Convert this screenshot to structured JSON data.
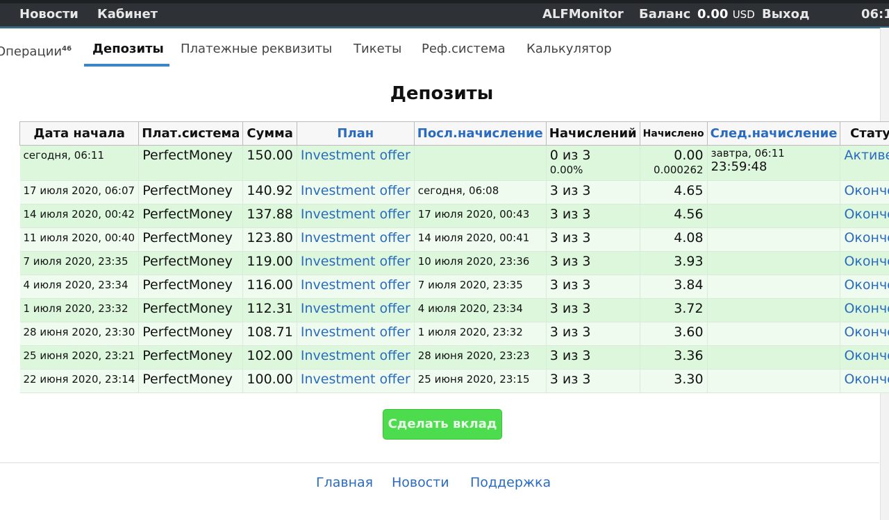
{
  "topbar": {
    "news": "Новости",
    "cabinet": "Кабинет",
    "username": "ALFMonitor",
    "balance_label": "Баланс",
    "balance_value": "0.00",
    "balance_currency": "USD",
    "logout": "Выход",
    "clock": "06:1"
  },
  "tabs": {
    "operations": "Операции",
    "operations_count": "46",
    "deposits": "Депозиты",
    "payment_details": "Платежные реквизиты",
    "tickets": "Тикеты",
    "referral": "Реф.система",
    "calculator": "Калькулятор"
  },
  "page": {
    "title": "Депозиты"
  },
  "table": {
    "headers": {
      "start_date": "Дата начала",
      "pay_system": "Плат.система",
      "amount": "Сумма",
      "plan": "План",
      "last_accrual": "Посл.начисление",
      "accruals": "Начислений",
      "accrued": "Начислено",
      "next_accrual": "След.начисление",
      "status": "Статус"
    },
    "rows": [
      {
        "start_date": "сегодня, 06:11",
        "pay_system": "PerfectMoney",
        "amount": "150.00",
        "plan": "Investment offer",
        "last_accrual": "",
        "accruals": "0 из 3",
        "accruals_pct": "0.00%",
        "accrued": "0.00",
        "accrued_sub": "0.000262",
        "next_accrual": "завтра, 06:11",
        "next_timer": "23:59:48",
        "status": "Активен"
      },
      {
        "start_date": "17 июля 2020, 06:07",
        "pay_system": "PerfectMoney",
        "amount": "140.92",
        "plan": "Investment offer",
        "last_accrual": "сегодня, 06:08",
        "accruals": "3 из 3",
        "accrued": "4.65",
        "status": "Окончен"
      },
      {
        "start_date": "14 июля 2020, 00:42",
        "pay_system": "PerfectMoney",
        "amount": "137.88",
        "plan": "Investment offer",
        "last_accrual": "17 июля 2020, 00:43",
        "accruals": "3 из 3",
        "accrued": "4.56",
        "status": "Окончен"
      },
      {
        "start_date": "11 июля 2020, 00:40",
        "pay_system": "PerfectMoney",
        "amount": "123.80",
        "plan": "Investment offer",
        "last_accrual": "14 июля 2020, 00:41",
        "accruals": "3 из 3",
        "accrued": "4.08",
        "status": "Окончен"
      },
      {
        "start_date": "7 июля 2020, 23:35",
        "pay_system": "PerfectMoney",
        "amount": "119.00",
        "plan": "Investment offer",
        "last_accrual": "10 июля 2020, 23:36",
        "accruals": "3 из 3",
        "accrued": "3.93",
        "status": "Окончен"
      },
      {
        "start_date": "4 июля 2020, 23:34",
        "pay_system": "PerfectMoney",
        "amount": "116.00",
        "plan": "Investment offer",
        "last_accrual": "7 июля 2020, 23:35",
        "accruals": "3 из 3",
        "accrued": "3.84",
        "status": "Окончен"
      },
      {
        "start_date": "1 июля 2020, 23:32",
        "pay_system": "PerfectMoney",
        "amount": "112.31",
        "plan": "Investment offer",
        "last_accrual": "4 июля 2020, 23:34",
        "accruals": "3 из 3",
        "accrued": "3.72",
        "status": "Окончен"
      },
      {
        "start_date": "28 июня 2020, 23:30",
        "pay_system": "PerfectMoney",
        "amount": "108.71",
        "plan": "Investment offer",
        "last_accrual": "1 июля 2020, 23:32",
        "accruals": "3 из 3",
        "accrued": "3.60",
        "status": "Окончен"
      },
      {
        "start_date": "25 июня 2020, 23:21",
        "pay_system": "PerfectMoney",
        "amount": "102.00",
        "plan": "Investment offer",
        "last_accrual": "28 июня 2020, 23:23",
        "accruals": "3 из 3",
        "accrued": "3.36",
        "status": "Окончен"
      },
      {
        "start_date": "22 июня 2020, 23:14",
        "pay_system": "PerfectMoney",
        "amount": "100.00",
        "plan": "Investment offer",
        "last_accrual": "25 июня 2020, 23:15",
        "accruals": "3 из 3",
        "accrued": "3.30",
        "status": "Окончен"
      }
    ]
  },
  "actions": {
    "make_deposit": "Сделать вклад"
  },
  "footer": {
    "home": "Главная",
    "news": "Новости",
    "support": "Поддержка"
  },
  "colors": {
    "topbar_bg": "#2e3236",
    "accent": "#3d86c6",
    "link": "#2a6bbf",
    "row_odd": "#dcf7dc",
    "row_even": "#effbef",
    "button": "#4ddc4d"
  }
}
